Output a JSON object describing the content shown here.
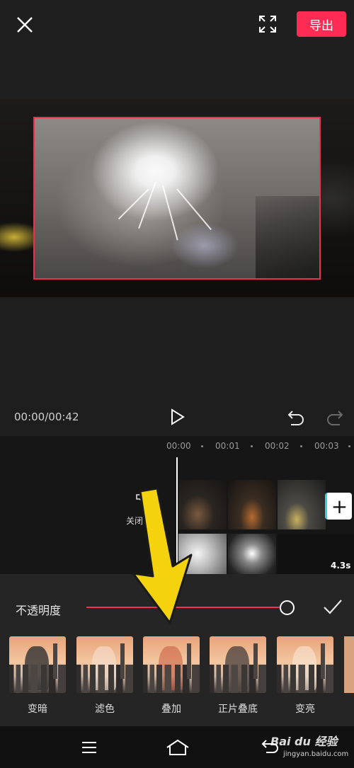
{
  "header": {
    "close_icon": "close-icon",
    "fullscreen_icon": "fullscreen-icon",
    "export_label": "导出",
    "accent_color": "#fe2c55"
  },
  "playback": {
    "time": "00:00/00:42",
    "play_icon": "play-icon",
    "undo_icon": "undo-icon",
    "redo_icon": "redo-icon"
  },
  "timeline": {
    "ticks": [
      "00:00",
      "00:01",
      "00:02",
      "00:03"
    ],
    "mute_label": "关闭",
    "add_icon": "+",
    "clip_duration": "4.3s"
  },
  "blend_panel": {
    "opacity_label": "不透明度",
    "opacity_value": 1.0,
    "confirm_icon": "check-icon",
    "modes": [
      {
        "label": "变暗"
      },
      {
        "label": "滤色"
      },
      {
        "label": "叠加"
      },
      {
        "label": "正片叠底"
      },
      {
        "label": "变亮"
      }
    ]
  },
  "navbar": {
    "menu_icon": "menu-icon",
    "home_icon": "home-icon",
    "back_icon": "back-icon"
  },
  "watermark": {
    "brand": "Bai du 经验",
    "url": "jingyan.baidu.com"
  }
}
